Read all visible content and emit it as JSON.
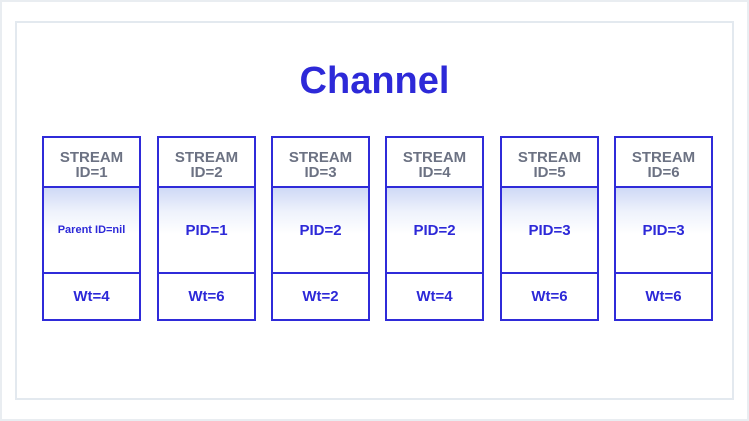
{
  "title": "Channel",
  "streams": [
    {
      "line1": "STREAM",
      "line2": "ID=1",
      "parent": "Parent ID=nil",
      "weight": "Wt=4"
    },
    {
      "line1": "STREAM",
      "line2": "ID=2",
      "parent": "PID=1",
      "weight": "Wt=6"
    },
    {
      "line1": "STREAM",
      "line2": "ID=3",
      "parent": "PID=2",
      "weight": "Wt=2"
    },
    {
      "line1": "STREAM",
      "line2": "ID=4",
      "parent": "PID=2",
      "weight": "Wt=4"
    },
    {
      "line1": "STREAM",
      "line2": "ID=5",
      "parent": "PID=3",
      "weight": "Wt=6"
    },
    {
      "line1": "STREAM",
      "line2": "ID=6",
      "parent": "PID=3",
      "weight": "Wt=6"
    }
  ],
  "colors": {
    "accent": "#2d29d8",
    "header_text": "#6c7283",
    "border": "#2f2bd9"
  }
}
